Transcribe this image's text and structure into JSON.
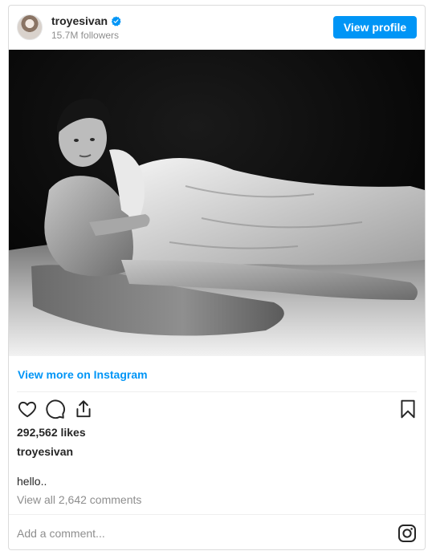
{
  "header": {
    "username": "troyesivan",
    "verified_icon": "verified-badge-icon",
    "followers": "15.7M followers",
    "view_profile_label": "View profile"
  },
  "post": {
    "image_alt": "troyesivan photo",
    "view_more_label": "View more on Instagram",
    "likes": "292,562 likes",
    "caption_user": "troyesivan",
    "caption_text": "hello..",
    "view_comments_label": "View all 2,642 comments"
  },
  "comment": {
    "placeholder": "Add a comment..."
  },
  "icons": {
    "like": "heart-icon",
    "comment": "comment-icon",
    "share": "share-icon",
    "save": "bookmark-icon",
    "instagram": "instagram-logo-icon"
  },
  "colors": {
    "accent": "#0095f6",
    "text": "#262626",
    "muted": "#8e8e8e",
    "border": "#dbdbdb"
  }
}
